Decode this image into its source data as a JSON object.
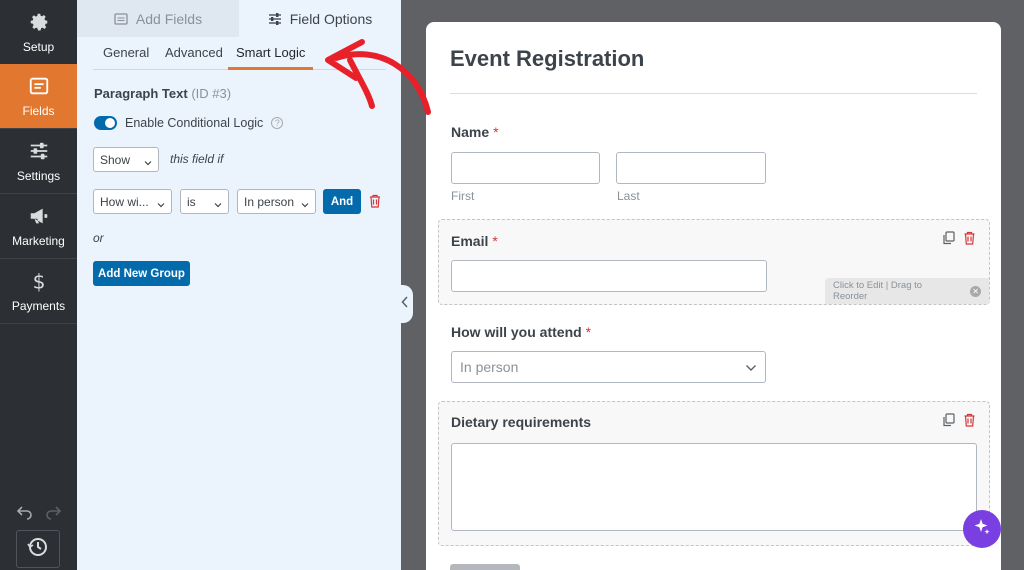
{
  "nav": {
    "items": [
      {
        "label": "Setup",
        "icon": "gear-icon"
      },
      {
        "label": "Fields",
        "icon": "fields-icon",
        "active": true
      },
      {
        "label": "Settings",
        "icon": "sliders-icon"
      },
      {
        "label": "Marketing",
        "icon": "megaphone-icon"
      },
      {
        "label": "Payments",
        "icon": "dollar-icon"
      }
    ]
  },
  "panel": {
    "top_tabs": {
      "add_fields": "Add Fields",
      "field_options": "Field Options"
    },
    "sub_tabs": {
      "general": "General",
      "advanced": "Advanced",
      "smart_logic": "Smart Logic"
    },
    "field_name": "Paragraph Text",
    "field_id": "(ID #3)",
    "toggle_label": "Enable Conditional Logic",
    "toggle_on": true,
    "show_select": "Show",
    "this_field_if": "this field if",
    "rule": {
      "field": "How wi...",
      "operator": "is",
      "value": "In person"
    },
    "and_button": "And",
    "or_text": "or",
    "add_group_button": "Add New Group"
  },
  "form": {
    "title": "Event Registration",
    "name_label": "Name",
    "first_label": "First",
    "last_label": "Last",
    "email_label": "Email",
    "edit_hint": "Click to Edit | Drag to Reorder",
    "attend_label": "How will you attend",
    "attend_value": "In person",
    "dietary_label": "Dietary requirements",
    "required_mark": "*"
  },
  "colors": {
    "accent_orange": "#e27730",
    "primary_blue": "#036aab",
    "required_red": "#d63638",
    "annotation_red": "#e8202a",
    "ai_purple": "#7a3fe0"
  }
}
